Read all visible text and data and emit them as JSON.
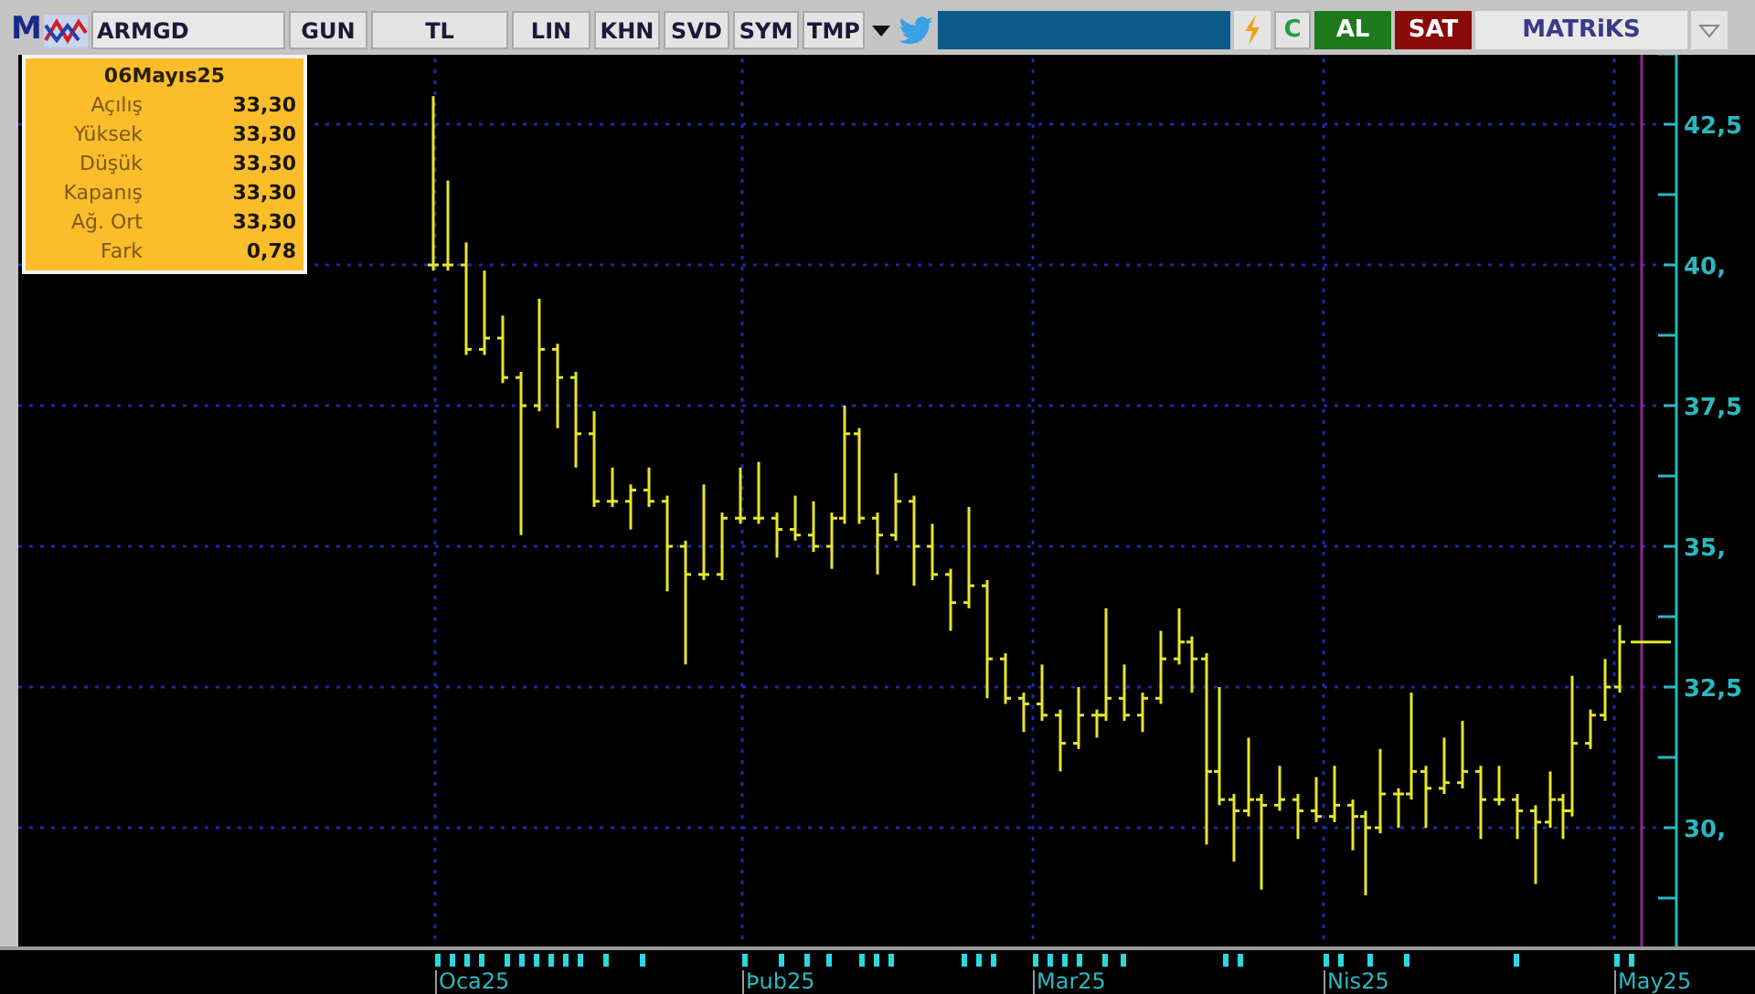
{
  "toolbar": {
    "logo": "M",
    "symbol": "ARMGD",
    "buttons": [
      "GUN",
      "TL",
      "LIN",
      "KHN",
      "SVD",
      "SYM",
      "TMP"
    ],
    "refresh": "C",
    "buy": "AL",
    "sell": "SAT",
    "brand": "MATRiKS"
  },
  "info_panel": {
    "date": "06Mayıs25",
    "rows": [
      {
        "label": "Açılış",
        "value": "33,30"
      },
      {
        "label": "Yüksek",
        "value": "33,30"
      },
      {
        "label": "Düşük",
        "value": "33,30"
      },
      {
        "label": "Kapanış",
        "value": "33,30"
      },
      {
        "label": "Ağ. Ort",
        "value": "33,30"
      },
      {
        "label": "Fark",
        "value": "0,78"
      }
    ]
  },
  "y_axis": {
    "labels": [
      "42,5",
      "40,",
      "37,5",
      "35,",
      "32,5",
      "30,"
    ]
  },
  "x_axis": {
    "labels": [
      "Oca25",
      "Þub25",
      "Mar25",
      "Nis25",
      "May25"
    ]
  }
}
